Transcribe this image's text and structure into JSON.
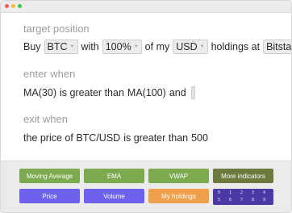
{
  "window": {
    "controls": [
      "close",
      "minimize",
      "maximize"
    ]
  },
  "target": {
    "label": "target position",
    "sentence": {
      "w1": "Buy",
      "asset": "BTC",
      "w2": "with",
      "percent": "100%",
      "w3": "of my",
      "currency": "USD",
      "w4": "holdings at",
      "exchange": "Bitstamp",
      "end": "."
    }
  },
  "enter": {
    "label": "enter when",
    "sentence": {
      "left": "MA(30)",
      "op": "is greater than",
      "right": "MA(100)",
      "conj": "and"
    }
  },
  "exit": {
    "label": "exit when",
    "sentence": {
      "left": "the price of BTC/USD",
      "op": "is greater than",
      "right": "500"
    }
  },
  "palette": {
    "row1": [
      {
        "label": "Moving Average",
        "color": "#7daa4f"
      },
      {
        "label": "EMA",
        "color": "#7daa4f"
      },
      {
        "label": "VWAP",
        "color": "#7daa4f"
      },
      {
        "label": "More indicators",
        "color": "#6c7a3e"
      }
    ],
    "row2": [
      {
        "label": "Price",
        "color": "#6f61f0"
      },
      {
        "label": "Volume",
        "color": "#6f61f0"
      },
      {
        "label": "My holdings",
        "color": "#f0a04b"
      }
    ],
    "numpad": {
      "row1": [
        "0",
        "1",
        "2",
        "3",
        "4"
      ],
      "row2": [
        "5",
        "6",
        "7",
        "8",
        "9"
      ],
      "color": "#4b3aa6"
    }
  }
}
